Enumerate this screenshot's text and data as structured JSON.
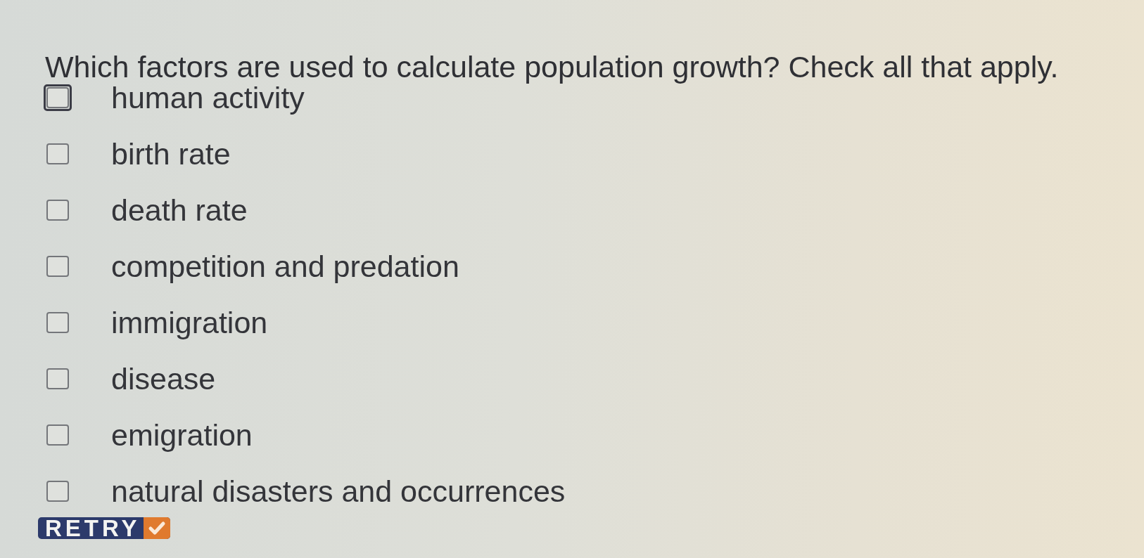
{
  "question": "Which factors are used to calculate population growth? Check all that apply.",
  "options": [
    {
      "label": "human activity",
      "checked": false,
      "focused": true
    },
    {
      "label": "birth rate",
      "checked": false,
      "focused": false
    },
    {
      "label": "death rate",
      "checked": false,
      "focused": false
    },
    {
      "label": "competition and predation",
      "checked": false,
      "focused": false
    },
    {
      "label": "immigration",
      "checked": false,
      "focused": false
    },
    {
      "label": "disease",
      "checked": false,
      "focused": false
    },
    {
      "label": "emigration",
      "checked": false,
      "focused": false
    },
    {
      "label": "natural disasters and occurrences",
      "checked": false,
      "focused": false
    }
  ],
  "retry_button": {
    "label": "RETRY"
  }
}
